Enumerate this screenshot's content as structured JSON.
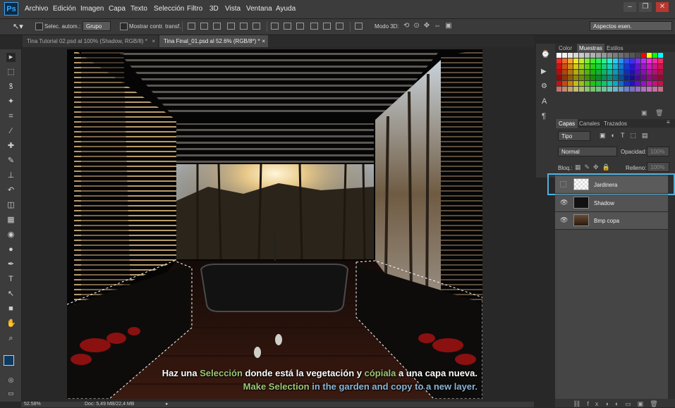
{
  "app": {
    "logo": "Ps"
  },
  "menu": [
    "Archivo",
    "Edición",
    "Imagen",
    "Capa",
    "Texto",
    "Selección",
    "Filtro",
    "3D",
    "Vista",
    "Ventana",
    "Ayuda"
  ],
  "window_controls": {
    "minimize": "–",
    "restore": "❐",
    "close": "✕"
  },
  "options": {
    "auto_select_label": "Selec. autom.:",
    "auto_select_value": "Grupo",
    "show_transform_label": "Mostrar contr. transf.",
    "mode_3d_label": "Modo 3D:",
    "workspace": "Aspectos esen."
  },
  "tabs": [
    {
      "label": "Tina Tutorial 02.psd al 100% (Shadow, RGB/8) *",
      "active": false
    },
    {
      "label": "Tina Final_01.psd al 52.6% (RGB/8*) *",
      "active": true
    }
  ],
  "tools": [
    "move-icon",
    "marquee-icon",
    "lasso-icon",
    "magic-wand-icon",
    "crop-icon",
    "eyedropper-icon",
    "healing-icon",
    "brush-icon",
    "stamp-icon",
    "history-brush-icon",
    "eraser-icon",
    "gradient-icon",
    "blur-icon",
    "dodge-icon",
    "pen-icon",
    "type-icon",
    "path-select-icon",
    "shape-icon",
    "hand-icon",
    "zoom-icon"
  ],
  "tool_glyphs": [
    "▸",
    "⬚",
    "ꝸ",
    "✦",
    "⌗",
    "⁄",
    "✚",
    "✎",
    "⊥",
    "↶",
    "◫",
    "▦",
    "◉",
    "●",
    "✒",
    "T",
    "↖",
    "■",
    "✋",
    "⌕"
  ],
  "swatch_panel": {
    "tabs": [
      "Color",
      "Muestras",
      "Estilos"
    ],
    "active": "Muestras"
  },
  "layers_panel": {
    "tabs": [
      "Capas",
      "Canales",
      "Trazados"
    ],
    "active": "Capas",
    "filter": "Tipo",
    "blend_mode": "Normal",
    "opacity_label": "Opacidad:",
    "opacity_value": "100%",
    "lock_label": "Bloq.:",
    "fill_label": "Relleno:",
    "fill_value": "100%",
    "layers": [
      {
        "name": "Jardinera",
        "visible": false,
        "selected": true
      },
      {
        "name": "Shadow",
        "visible": true,
        "selected": false
      },
      {
        "name": "Bmp copa",
        "visible": true,
        "selected": false
      }
    ]
  },
  "status": {
    "zoom": "52.58%",
    "doc": "Doc: 5,49 MB/22,4 MB"
  },
  "subtitle": {
    "es_part1": "Haz una ",
    "es_hl1": "Selección",
    "es_part2": " donde está la vegetación y ",
    "es_hl2": "cópiala",
    "es_part3": " a una capa nueva.",
    "en_part1": "Make Selection",
    "en_part2": " in the garden and copy to a new layer."
  },
  "colors": {
    "accent": "#31a8ff",
    "selection_highlight": "#4fb3e0",
    "subtitle_green": "#9bc775",
    "subtitle_blue": "#8ab5d8"
  }
}
